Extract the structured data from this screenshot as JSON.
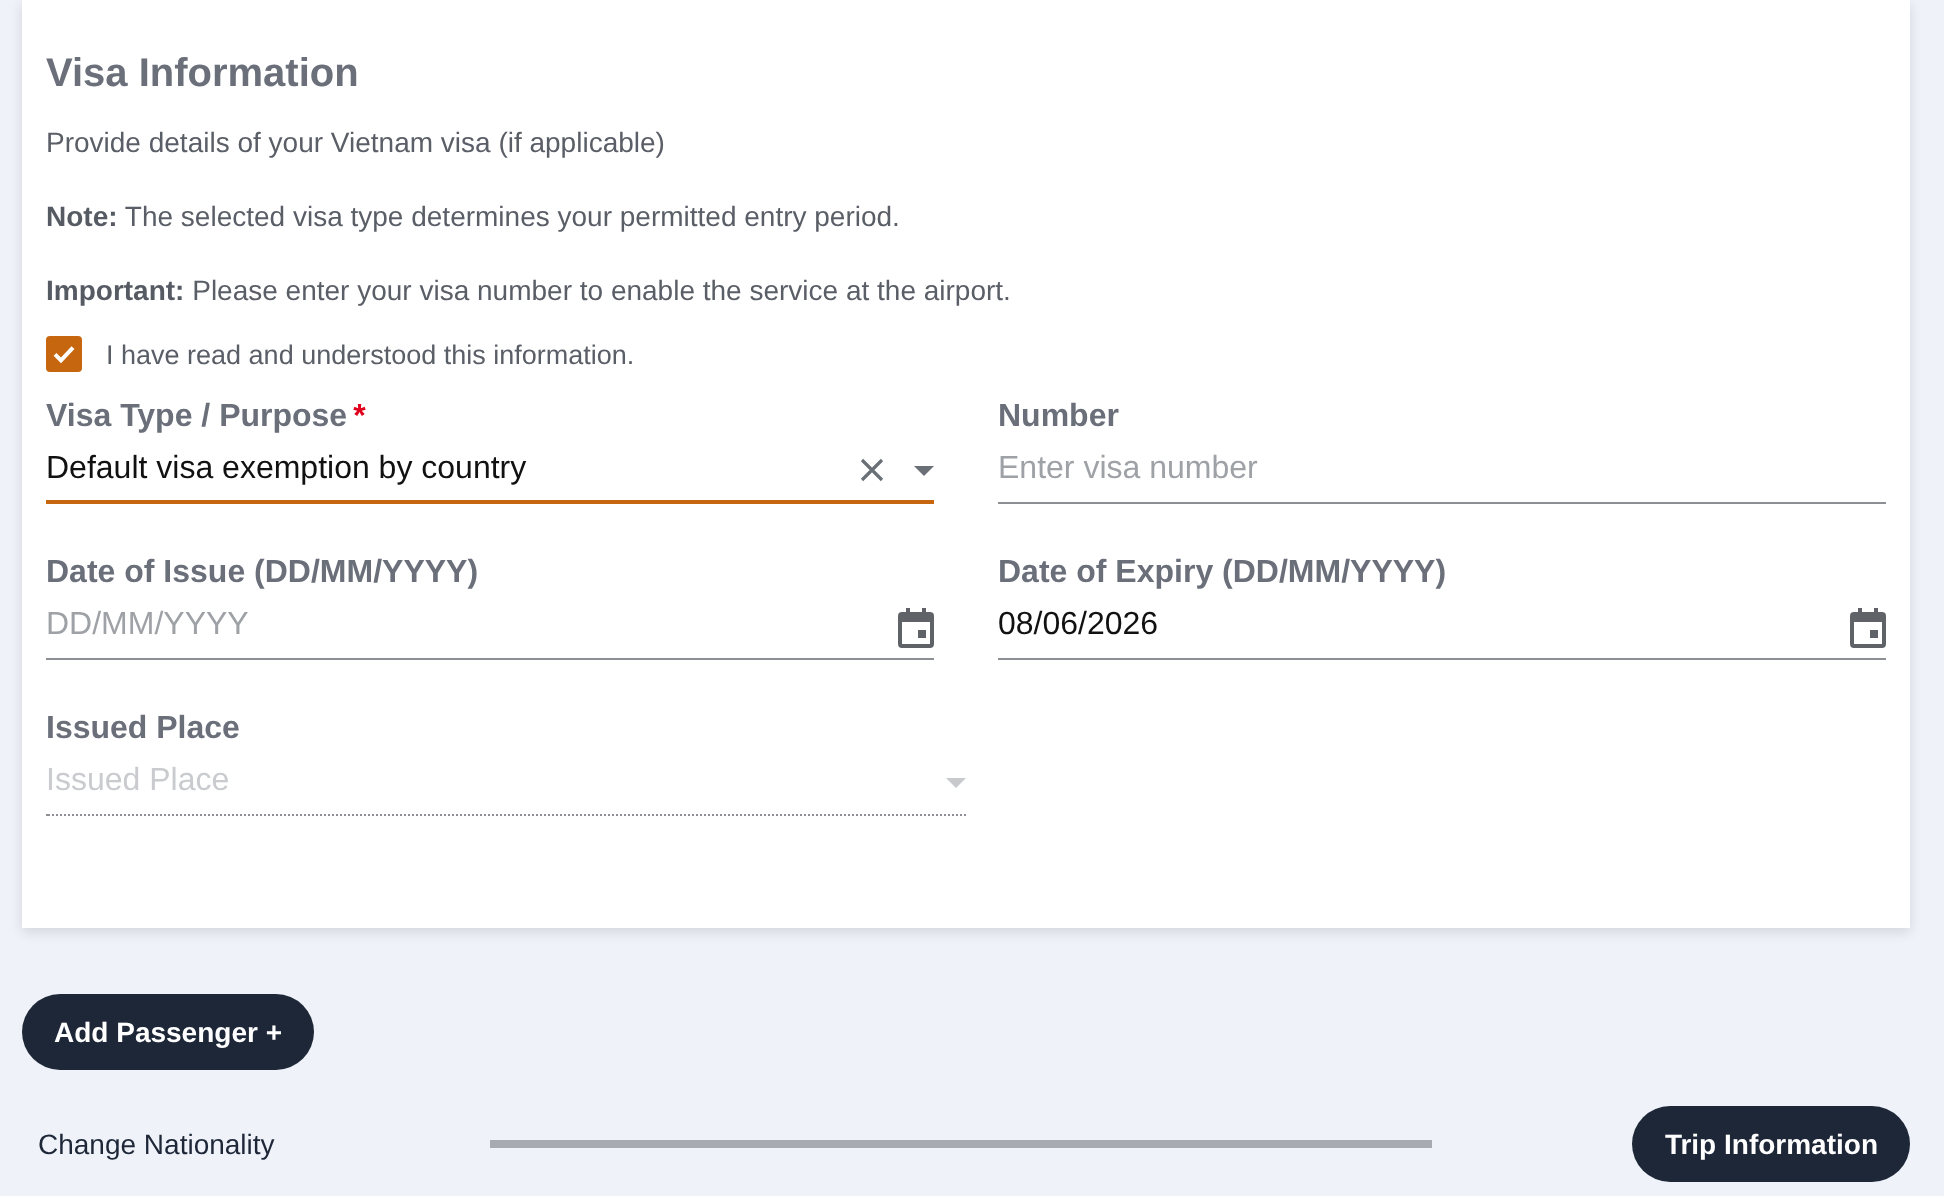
{
  "section": {
    "title": "Visa Information",
    "intro": "Provide details of your Vietnam visa (if applicable)",
    "notes": [
      "**Note:** The selected visa type determines your permitted entry period.",
      "**Important:** Please enter your visa number to enable the service at the airport."
    ],
    "acknowledge": {
      "label": "I have read and understood this information.",
      "checked": true
    }
  },
  "fields": [
    {
      "kind": "select",
      "label": "Visa Type / Purpose",
      "required_mark": "*",
      "value": "Default visa exemption by country",
      "focused": true,
      "clearable": true,
      "disabled": false
    },
    {
      "kind": "text",
      "label": "Number",
      "placeholder": "Enter visa number",
      "focused": false,
      "disabled": false
    },
    {
      "kind": "date",
      "label": "Date of Issue (DD/MM/YYYY)",
      "placeholder": "DD/MM/YYYY",
      "focused": false,
      "disabled": false
    },
    {
      "kind": "date",
      "label": "Date of Expiry (DD/MM/YYYY)",
      "value": "08/06/2026",
      "focused": false,
      "disabled": false
    },
    {
      "kind": "select",
      "label": "Issued Place",
      "placeholder": "Issued Place",
      "focused": false,
      "clearable": false,
      "disabled": true
    }
  ],
  "add_button": "Add Passenger +",
  "footer": {
    "back_link": "Change Nationality",
    "next_button": "Trip Information"
  }
}
